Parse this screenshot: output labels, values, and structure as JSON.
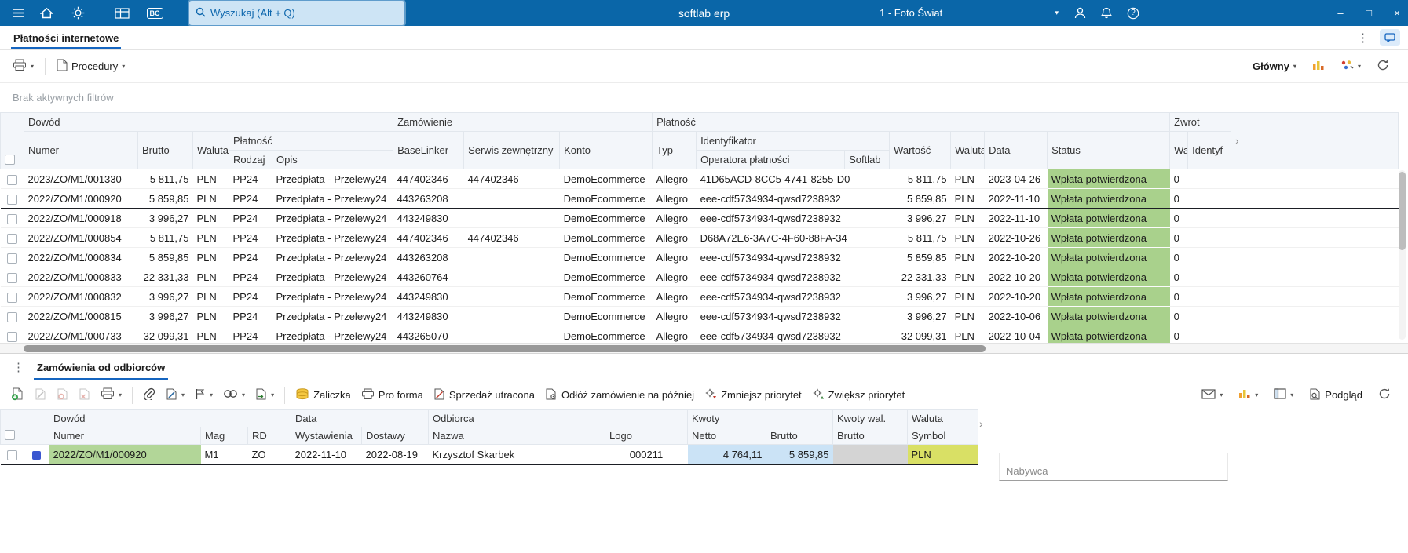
{
  "topbar": {
    "title": "softlab erp",
    "search_placeholder": "Wyszukaj (Alt + Q)",
    "company": "1 - Foto Świat"
  },
  "icons": {
    "chevron_down": "▾",
    "chevron_right": "›",
    "dots_vertical": "⋮",
    "minimize": "–",
    "maximize": "□",
    "close": "×",
    "bc": "BC",
    "question": "?"
  },
  "tab": {
    "label": "Płatności internetowe"
  },
  "toolbar": {
    "procedures": "Procedury",
    "view": "Główny"
  },
  "filter": {
    "empty": "Brak aktywnych filtrów"
  },
  "colors": {
    "topbar_bg": "#0a66a8",
    "accent": "#1565c0",
    "status_green": "#a9d18c",
    "row_highlight_green": "#b2d698",
    "amount_cell_blue": "#cbe3f6",
    "currency_cell_yellow": "#d9e065",
    "muted_cell_gray": "#d4d4d4"
  },
  "payments": {
    "groups": {
      "dowod": "Dowód",
      "zamowienie": "Zamówienie",
      "platnosc": "Płatność",
      "zwrot": "Zwrot"
    },
    "columns": {
      "numer": "Numer",
      "brutto": "Brutto",
      "waluta": "Waluta",
      "platnosc": "Płatność",
      "rodzaj": "Rodzaj",
      "opis": "Opis",
      "baselinker": "BaseLinker",
      "serwis": "Serwis zewnętrzny",
      "konto": "Konto",
      "typ": "Typ",
      "identyfikator": "Identyfikator",
      "operatora": "Operatora płatności",
      "softlab": "Softlab",
      "wartosc": "Wartość",
      "waluta2": "Waluta",
      "data": "Data",
      "status": "Status",
      "zwrot_waluta": "Wa",
      "zwrot_id": "Identyf"
    },
    "rows": [
      {
        "numer": "2023/ZO/M1/001330",
        "brutto": "5 811,75",
        "waluta": "PLN",
        "rodzaj": "PP24",
        "opis": "Przedpłata - Przelewy24",
        "baselinker": "447402346",
        "serwis": "447402346",
        "konto": "DemoEcommerce",
        "typ": "Allegro",
        "identyfikator": "41D65ACD-8CC5-4741-8255-D0",
        "wartosc": "5 811,75",
        "waluta2": "PLN",
        "data": "2023-04-26",
        "status": "Wpłata potwierdzona",
        "zwrot_wa": "0",
        "zwrot_id": "",
        "selected": false
      },
      {
        "numer": "2022/ZO/M1/000920",
        "brutto": "5 859,85",
        "waluta": "PLN",
        "rodzaj": "PP24",
        "opis": "Przedpłata - Przelewy24",
        "baselinker": "443263208",
        "serwis": "",
        "konto": "DemoEcommerce",
        "typ": "Allegro",
        "identyfikator": "eee-cdf5734934-qwsd7238932",
        "wartosc": "5 859,85",
        "waluta2": "PLN",
        "data": "2022-11-10",
        "status": "Wpłata potwierdzona",
        "zwrot_wa": "0",
        "zwrot_id": "",
        "selected": true
      },
      {
        "numer": "2022/ZO/M1/000918",
        "brutto": "3 996,27",
        "waluta": "PLN",
        "rodzaj": "PP24",
        "opis": "Przedpłata - Przelewy24",
        "baselinker": "443249830",
        "serwis": "",
        "konto": "DemoEcommerce",
        "typ": "Allegro",
        "identyfikator": "eee-cdf5734934-qwsd7238932",
        "wartosc": "3 996,27",
        "waluta2": "PLN",
        "data": "2022-11-10",
        "status": "Wpłata potwierdzona",
        "zwrot_wa": "0",
        "zwrot_id": "",
        "selected": false
      },
      {
        "numer": "2022/ZO/M1/000854",
        "brutto": "5 811,75",
        "waluta": "PLN",
        "rodzaj": "PP24",
        "opis": "Przedpłata - Przelewy24",
        "baselinker": "447402346",
        "serwis": "447402346",
        "konto": "DemoEcommerce",
        "typ": "Allegro",
        "identyfikator": "D68A72E6-3A7C-4F60-88FA-34",
        "wartosc": "5 811,75",
        "waluta2": "PLN",
        "data": "2022-10-26",
        "status": "Wpłata potwierdzona",
        "zwrot_wa": "0",
        "zwrot_id": "",
        "selected": false
      },
      {
        "numer": "2022/ZO/M1/000834",
        "brutto": "5 859,85",
        "waluta": "PLN",
        "rodzaj": "PP24",
        "opis": "Przedpłata - Przelewy24",
        "baselinker": "443263208",
        "serwis": "",
        "konto": "DemoEcommerce",
        "typ": "Allegro",
        "identyfikator": "eee-cdf5734934-qwsd7238932",
        "wartosc": "5 859,85",
        "waluta2": "PLN",
        "data": "2022-10-20",
        "status": "Wpłata potwierdzona",
        "zwrot_wa": "0",
        "zwrot_id": "",
        "selected": false
      },
      {
        "numer": "2022/ZO/M1/000833",
        "brutto": "22 331,33",
        "waluta": "PLN",
        "rodzaj": "PP24",
        "opis": "Przedpłata - Przelewy24",
        "baselinker": "443260764",
        "serwis": "",
        "konto": "DemoEcommerce",
        "typ": "Allegro",
        "identyfikator": "eee-cdf5734934-qwsd7238932",
        "wartosc": "22 331,33",
        "waluta2": "PLN",
        "data": "2022-10-20",
        "status": "Wpłata potwierdzona",
        "zwrot_wa": "0",
        "zwrot_id": "",
        "selected": false
      },
      {
        "numer": "2022/ZO/M1/000832",
        "brutto": "3 996,27",
        "waluta": "PLN",
        "rodzaj": "PP24",
        "opis": "Przedpłata - Przelewy24",
        "baselinker": "443249830",
        "serwis": "",
        "konto": "DemoEcommerce",
        "typ": "Allegro",
        "identyfikator": "eee-cdf5734934-qwsd7238932",
        "wartosc": "3 996,27",
        "waluta2": "PLN",
        "data": "2022-10-20",
        "status": "Wpłata potwierdzona",
        "zwrot_wa": "0",
        "zwrot_id": "",
        "selected": false
      },
      {
        "numer": "2022/ZO/M1/000815",
        "brutto": "3 996,27",
        "waluta": "PLN",
        "rodzaj": "PP24",
        "opis": "Przedpłata - Przelewy24",
        "baselinker": "443249830",
        "serwis": "",
        "konto": "DemoEcommerce",
        "typ": "Allegro",
        "identyfikator": "eee-cdf5734934-qwsd7238932",
        "wartosc": "3 996,27",
        "waluta2": "PLN",
        "data": "2022-10-06",
        "status": "Wpłata potwierdzona",
        "zwrot_wa": "0",
        "zwrot_id": "",
        "selected": false
      },
      {
        "numer": "2022/ZO/M1/000733",
        "brutto": "32 099,31",
        "waluta": "PLN",
        "rodzaj": "PP24",
        "opis": "Przedpłata - Przelewy24",
        "baselinker": "443265070",
        "serwis": "",
        "konto": "DemoEcommerce",
        "typ": "Allegro",
        "identyfikator": "eee-cdf5734934-qwsd7238932",
        "wartosc": "32 099,31",
        "waluta2": "PLN",
        "data": "2022-10-04",
        "status": "Wpłata potwierdzona",
        "zwrot_wa": "0",
        "zwrot_id": "",
        "selected": false
      }
    ]
  },
  "orders": {
    "tab": "Zamówienia od odbiorców",
    "toolbar": {
      "zaliczka": "Zaliczka",
      "proforma": "Pro forma",
      "sprzedaz_utracona": "Sprzedaż utracona",
      "odloz": "Odłóż zamówienie na później",
      "zmniejsz": "Zmniejsz priorytet",
      "zwieksz": "Zwiększ priorytet",
      "podglad": "Podgląd"
    },
    "groups": {
      "dowod": "Dowód",
      "data": "Data",
      "odbiorca": "Odbiorca",
      "kwoty": "Kwoty",
      "kwoty_wal": "Kwoty wal.",
      "waluta": "Waluta"
    },
    "columns": {
      "numer": "Numer",
      "mag": "Mag",
      "rd": "RD",
      "wystawienia": "Wystawienia",
      "dostawy": "Dostawy",
      "nazwa": "Nazwa",
      "logo": "Logo",
      "netto": "Netto",
      "brutto": "Brutto",
      "brutto_wal": "Brutto",
      "symbol": "Symbol"
    },
    "row": {
      "numer": "2022/ZO/M1/000920",
      "mag": "M1",
      "rd": "ZO",
      "wystawienia": "2022-11-10",
      "dostawy": "2022-08-19",
      "nazwa": "Krzysztof Skarbek",
      "logo": "000211",
      "netto": "4 764,11",
      "brutto": "5 859,85",
      "brutto_wal": "",
      "symbol": "PLN"
    },
    "nabywca_label": "Nabywca"
  }
}
